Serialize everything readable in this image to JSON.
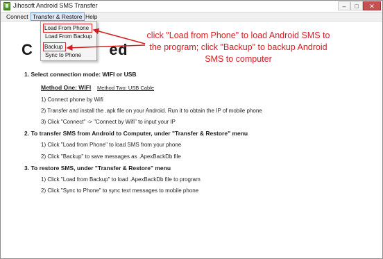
{
  "window": {
    "title": "Jihosoft Android SMS Transfer",
    "min": "–",
    "max": "□",
    "close": "✕"
  },
  "menubar": {
    "connect": "Connect",
    "transfer_restore": "Transfer & Restore",
    "help": "Help"
  },
  "dropdown": {
    "items": [
      "Load From Phone",
      "Load From Backup",
      "Backup",
      "Sync to Phone"
    ]
  },
  "main": {
    "title_start": "C",
    "title_end": "ed"
  },
  "annotation": {
    "text": "click \"Load from Phone\" to load Android SMS to the program; click \"Backup\" to backup Android SMS to computer",
    "color": "#d41e22"
  },
  "steps": {
    "s1_heading": "1. Select connection mode: WIFI or USB",
    "method_one": "Method One: WIFI",
    "method_two": "Method Two: USB Cable",
    "s1_items": [
      "1) Connect phone by Wifi",
      "2) Transfer and install the .apk file on your Android. Run it to obtain the IP of mobile phone",
      "3) Click \"Connect\" -> \"Connect by Wifi\" to input your IP"
    ],
    "s2_heading": "2. To transfer SMS from Android to Computer, under \"Transfer & Restore\" menu",
    "s2_items": [
      "1) Click \"Load from Phone\" to load SMS from your phone",
      "2) Click \"Backup\" to save messages as .ApexBackDb file"
    ],
    "s3_heading": "3. To restore SMS, under \"Transfer & Restore\" menu",
    "s3_items": [
      "1) Click \"Load from Backup\" to load .ApexBackDb file to program",
      "2) Click \"Sync to Phone\" to sync text messages to mobile phone"
    ]
  }
}
